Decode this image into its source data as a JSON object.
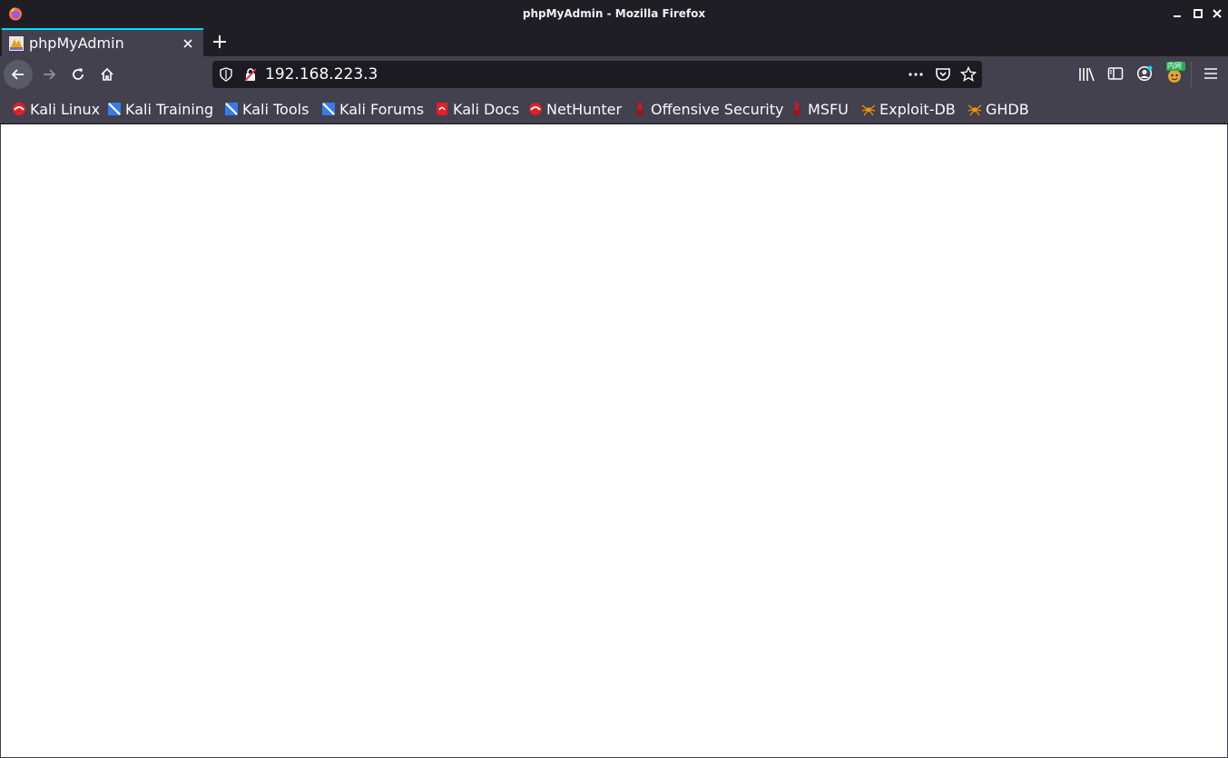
{
  "window": {
    "title": "phpMyAdmin - Mozilla Firefox"
  },
  "tab": {
    "title": "phpMyAdmin",
    "favicon": "phpmyadmin-favicon"
  },
  "navbar": {
    "url": "192.168.223.3"
  },
  "extension": {
    "badge": "内网"
  },
  "bookmarks": [
    {
      "label": "Kali Linux",
      "icon": "kali-icon"
    },
    {
      "label": "Kali Training",
      "icon": "kali-training-icon"
    },
    {
      "label": "Kali Tools",
      "icon": "kali-tools-icon"
    },
    {
      "label": "Kali Forums",
      "icon": "kali-forums-icon"
    },
    {
      "label": "Kali Docs",
      "icon": "kali-docs-icon"
    },
    {
      "label": "NetHunter",
      "icon": "nethunter-icon"
    },
    {
      "label": "Offensive Security",
      "icon": "offsec-icon"
    },
    {
      "label": "MSFU",
      "icon": "msfu-icon"
    },
    {
      "label": "Exploit-DB",
      "icon": "exploitdb-icon"
    },
    {
      "label": "GHDB",
      "icon": "ghdb-icon"
    }
  ],
  "colors": {
    "chrome_dark": "#1f1e25",
    "toolbar": "#42414d",
    "accent": "#00ddff"
  }
}
